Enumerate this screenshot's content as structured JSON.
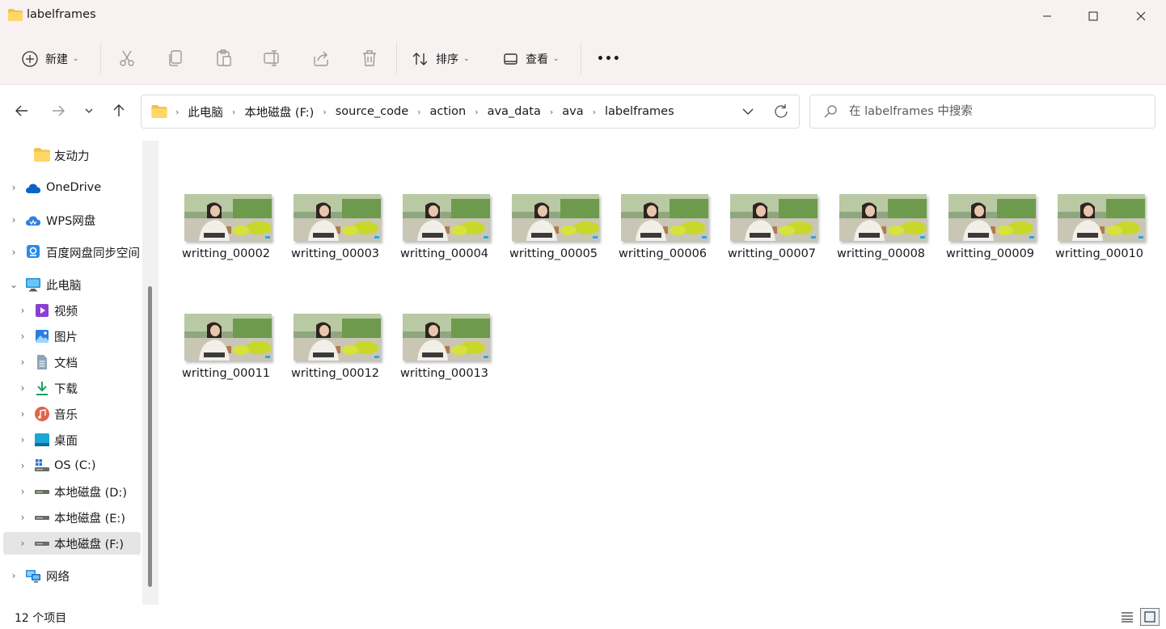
{
  "window": {
    "title": "labelframes",
    "minimize_icon": "minimize-icon",
    "maximize_icon": "maximize-icon",
    "close_icon": "close-icon"
  },
  "toolbar": {
    "new_label": "新建",
    "sort_label": "排序",
    "view_label": "查看",
    "more_label": "•••",
    "icons": [
      "cut-icon",
      "copy-icon",
      "paste-icon",
      "rename-icon",
      "share-icon",
      "delete-icon"
    ]
  },
  "address": {
    "crumbs": [
      "此电脑",
      "本地磁盘 (F:)",
      "source_code",
      "action",
      "ava_data",
      "ava",
      "labelframes"
    ]
  },
  "search": {
    "placeholder": "在 labelframes 中搜索"
  },
  "sidebar": {
    "items": [
      {
        "label": "友动力",
        "icon": "folder-icon"
      },
      {
        "label": "OneDrive",
        "icon": "cloud-icon"
      },
      {
        "label": "WPS网盘",
        "icon": "cloud-icon"
      },
      {
        "label": "百度网盘同步空间",
        "icon": "baidu-icon"
      },
      {
        "label": "此电脑",
        "icon": "computer-icon"
      },
      {
        "label": "视频",
        "icon": "video-icon"
      },
      {
        "label": "图片",
        "icon": "picture-icon"
      },
      {
        "label": "文档",
        "icon": "document-icon"
      },
      {
        "label": "下载",
        "icon": "download-icon"
      },
      {
        "label": "音乐",
        "icon": "music-icon"
      },
      {
        "label": "桌面",
        "icon": "desktop-icon"
      },
      {
        "label": "OS (C:)",
        "icon": "windows-drive-icon"
      },
      {
        "label": "本地磁盘 (D:)",
        "icon": "drive-icon"
      },
      {
        "label": "本地磁盘 (E:)",
        "icon": "drive-icon"
      },
      {
        "label": "本地磁盘 (F:)",
        "icon": "drive-icon"
      },
      {
        "label": "网络",
        "icon": "network-icon"
      }
    ]
  },
  "files": [
    "writting_00002",
    "writting_00003",
    "writting_00004",
    "writting_00005",
    "writting_00006",
    "writting_00007",
    "writting_00008",
    "writting_00009",
    "writting_00010",
    "writting_00011",
    "writting_00012",
    "writting_00013"
  ],
  "status": {
    "count_text": "12 个项目"
  },
  "colors": {
    "titlebar_bg": "#f7f1f1",
    "selected_bg": "#e5e5e5",
    "folder_yellow": "#f2c14b",
    "accent": "#0067c0"
  }
}
